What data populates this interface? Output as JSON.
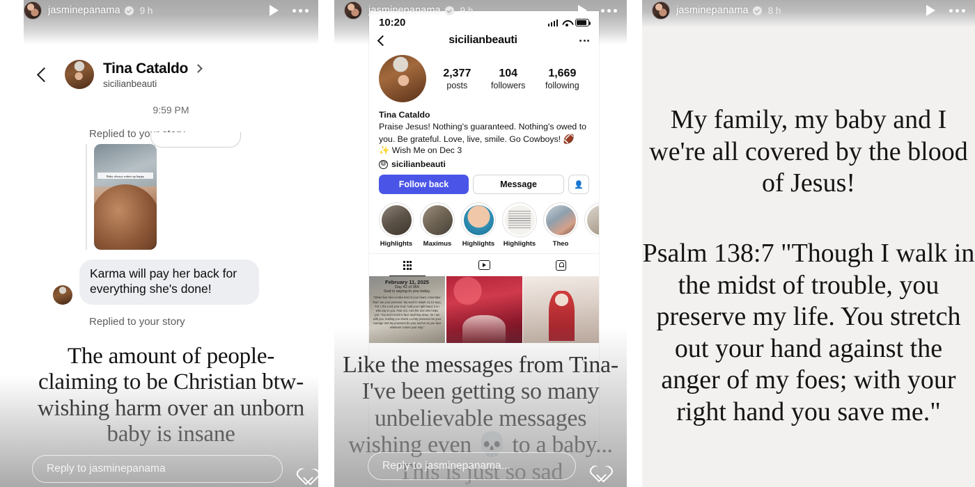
{
  "panel1": {
    "story_header": {
      "username": "jasminepanama",
      "age": "9 h",
      "verified_icon": "verified-badge-icon",
      "play_icon": "play-icon",
      "more_icon": "more-options-icon"
    },
    "dm": {
      "back_icon": "chevron-left-icon",
      "name": "Tina Cataldo",
      "name_chevron_icon": "chevron-right-icon",
      "handle": "sicilianbeauti",
      "timestamp": "9:59 PM",
      "reply_label_1": "Replied to your story",
      "story_thumb_caption": "Baby always wakes up happy",
      "message": "Karma will pay her back for everything she's done!",
      "reply_label_2": "Replied to your story"
    },
    "overlay_text": "The amount of people-claiming to be Christian btw-wishing harm over an unborn baby is insane",
    "reply_bar": {
      "placeholder": "Reply to jasminepanama",
      "heart_icon": "heart-icon"
    }
  },
  "panel2": {
    "story_header": {
      "username": "jasminepanama",
      "age": "9 h",
      "verified_icon": "verified-badge-icon",
      "play_icon": "play-icon",
      "more_icon": "more-options-icon"
    },
    "phone": {
      "status_time": "10:20",
      "signal_icon": "cellular-signal-icon",
      "wifi_icon": "wifi-icon",
      "battery_icon": "battery-icon",
      "nav_back_icon": "chevron-left-icon",
      "title": "sicilianbeauti",
      "more_icon": "more-options-icon",
      "stats": [
        {
          "value": "2,377",
          "label": "posts"
        },
        {
          "value": "104",
          "label": "followers"
        },
        {
          "value": "1,669",
          "label": "following"
        }
      ],
      "bio_name": "Tina Cataldo",
      "bio_line1": "Praise Jesus! Nothing's guaranteed. Nothing's owed to you. Be grateful. Love, live, smile. Go Cowboys!",
      "bio_emoji": "🏈",
      "bio_line2": "✨ Wish Me on Dec 3",
      "threads_handle": "sicilianbeauti",
      "btn_follow": "Follow back",
      "btn_message": "Message",
      "btn_add_icon": "add-person-icon",
      "highlights": [
        {
          "label": "Highlights"
        },
        {
          "label": "Maximus"
        },
        {
          "label": "Highlights"
        },
        {
          "label": "Highlights"
        },
        {
          "label": "Theo"
        },
        {
          "label": "H"
        }
      ],
      "tabs": [
        {
          "icon": "grid-icon",
          "active": true
        },
        {
          "icon": "reels-icon",
          "active": false
        },
        {
          "icon": "tagged-icon",
          "active": false
        }
      ],
      "post1_title": "February 11, 2025",
      "post1_sub": "Day 42 of 365",
      "post1_sub2": "God is saying to you today,",
      "post1_body": "\"When fear tries to take hold of your heart, remember that I am your protector. My word in Isaiah 41:13 says, 'For I, the Lord your God, hold your right hand; it is I who say to you, Fear not, I am the one who helps you.' You don't need to face anything alone, for I am with you, holding you shield. Let My presence be your courage and My promises be your anchor as you face whatever comes your way.\""
    },
    "overlay_text": "Like the messages from Tina- I've been getting so many unbelievable messages wishing even 💀 to a baby... This is just so sad",
    "reply_bar": {
      "placeholder": "Reply to jasminepanama...",
      "heart_icon": "heart-icon"
    }
  },
  "panel3": {
    "story_header": {
      "username": "jasminepanama",
      "age": "8 h",
      "verified_icon": "verified-badge-icon",
      "play_icon": "play-icon",
      "more_icon": "more-options-icon"
    },
    "text_block_1": "My family, my baby and I we're all covered by the blood of Jesus!",
    "text_block_2": "Psalm 138:7 \"Though I walk in the midst of trouble, you preserve my life. You stretch out your hand against the anger of my foes; with your right hand you save me.\""
  }
}
